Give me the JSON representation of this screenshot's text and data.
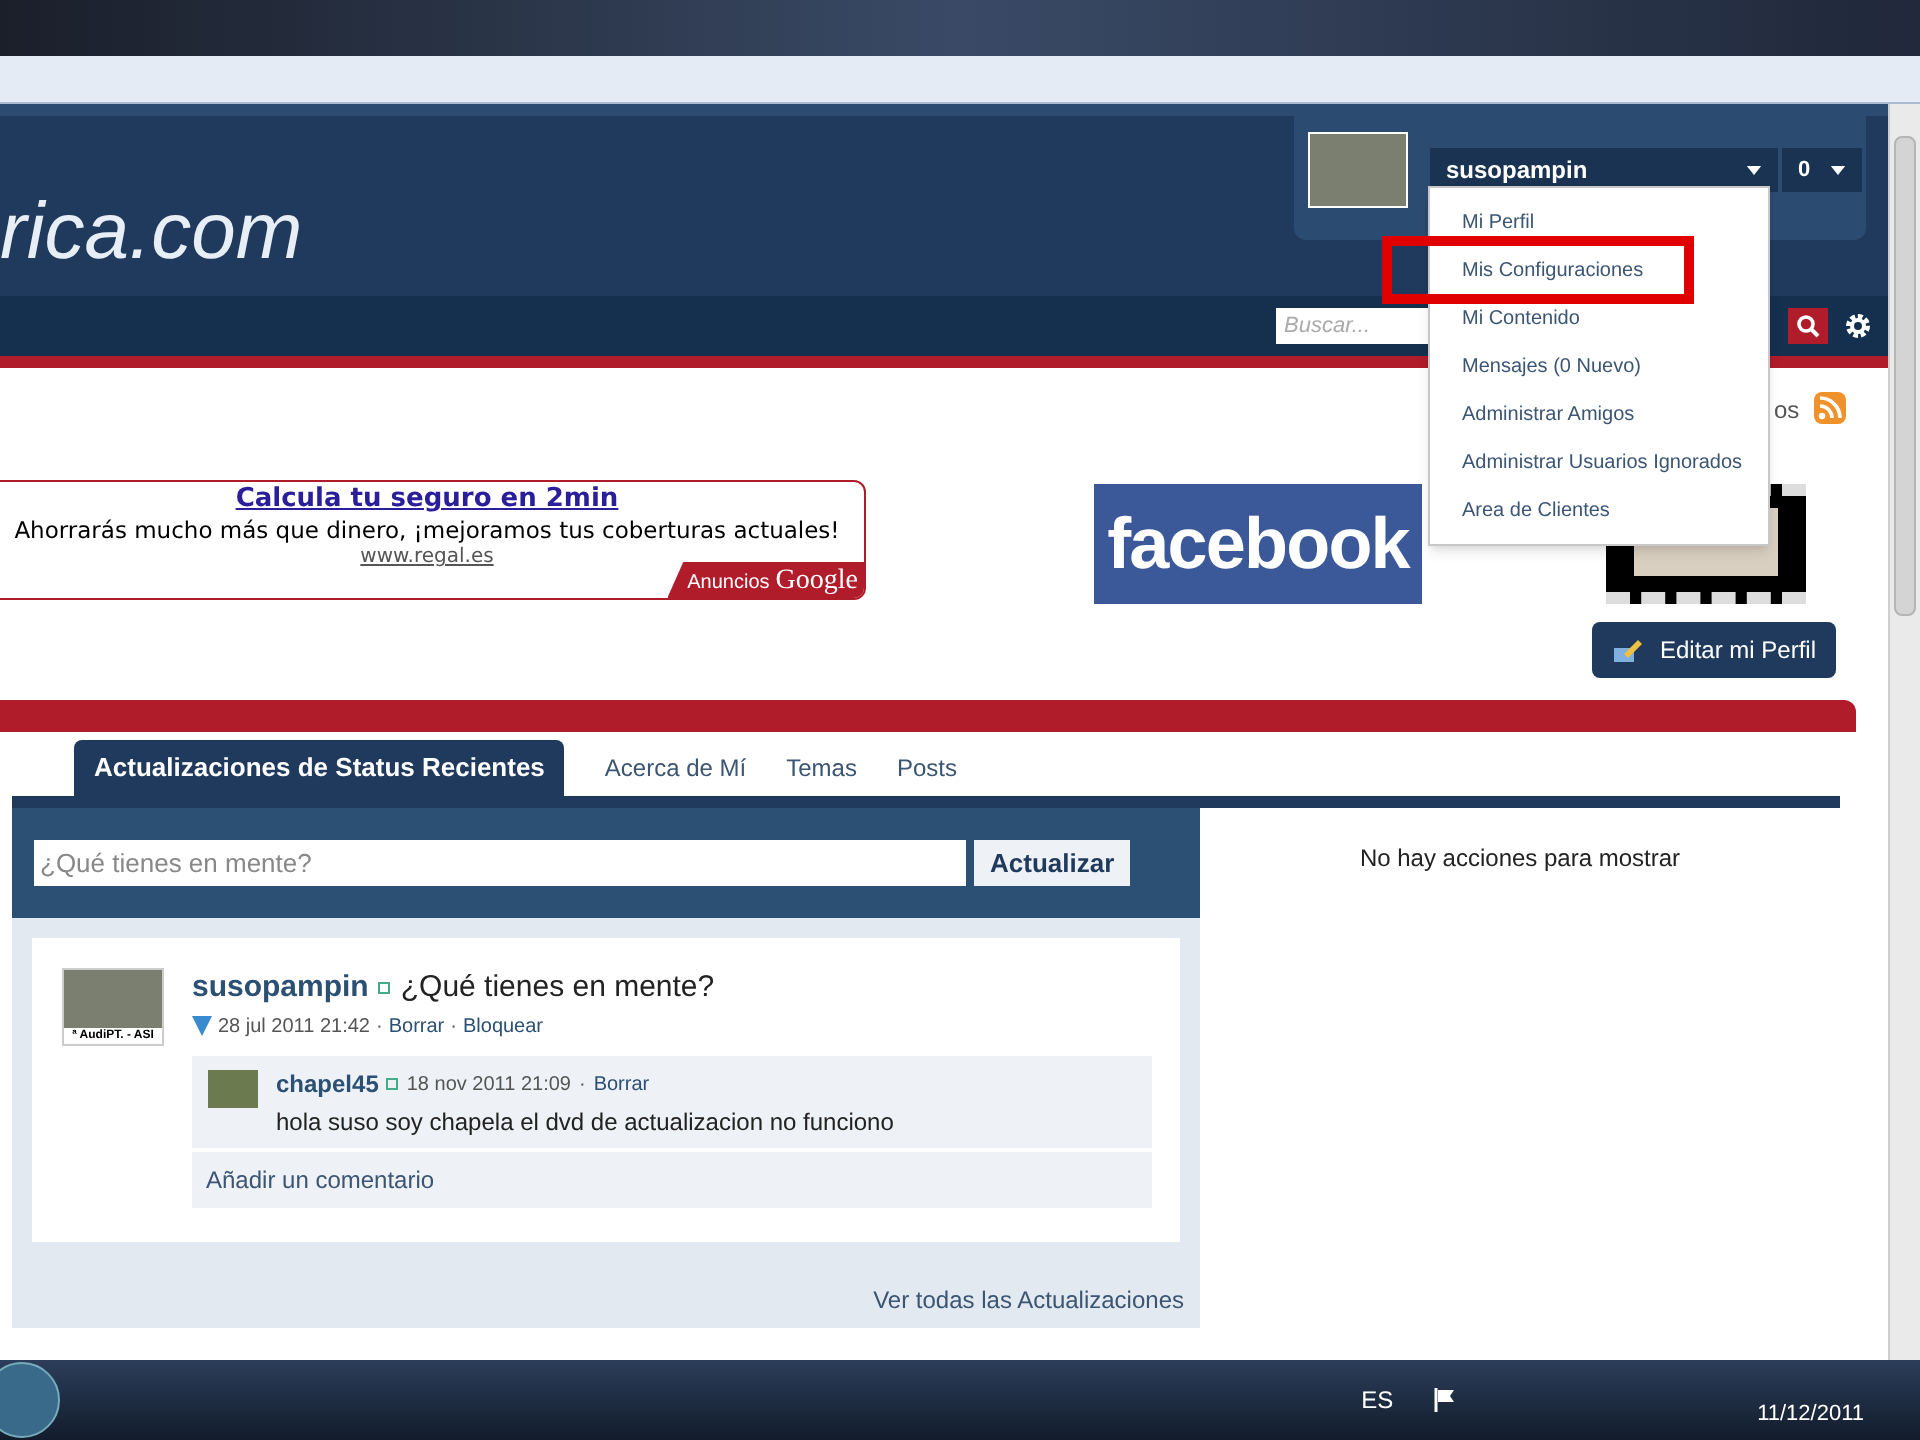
{
  "header": {
    "logo_text": "rica.com",
    "username": "susopampin",
    "notification_count": "0",
    "search": {
      "placeholder": "Buscar..."
    }
  },
  "user_menu": {
    "items": [
      {
        "label": "Mi Perfil",
        "highlighted": false
      },
      {
        "label": "Mis Configuraciones",
        "highlighted": true
      },
      {
        "label": "Mi Contenido",
        "highlighted": false
      },
      {
        "label": "Mensajes (0 Nuevo)",
        "highlighted": false
      },
      {
        "label": "Administrar Amigos",
        "highlighted": false
      },
      {
        "label": "Administrar Usuarios Ignorados",
        "highlighted": false
      },
      {
        "label": "Area de Clientes",
        "highlighted": false
      }
    ]
  },
  "rss_label": "os",
  "ad": {
    "title": "Calcula tu seguro en 2min",
    "text": "Ahorrarás mucho más que dinero, ¡mejoramos tus coberturas actuales!",
    "url": "www.regal.es",
    "label": "Anuncios",
    "brand": "Google"
  },
  "facebook_banner": "facebook",
  "edit_profile_button": "Editar mi Perfil",
  "tabs": [
    {
      "label": "Actualizaciones de Status Recientes",
      "selected": true
    },
    {
      "label": "Acerca de Mí",
      "selected": false
    },
    {
      "label": "Temas",
      "selected": false
    },
    {
      "label": "Posts",
      "selected": false
    }
  ],
  "status_box": {
    "placeholder": "¿Qué tienes en mente?",
    "button": "Actualizar"
  },
  "post": {
    "user": "susopampin",
    "text": "¿Qué tienes en mente?",
    "date": "28 jul 2011 21:42",
    "actions": [
      "Borrar",
      "Bloquear"
    ],
    "avatar_caption": "ª AudiPT. - ASI",
    "comments": [
      {
        "user": "chapel45",
        "date": "18 nov 2011 21:09",
        "actions": [
          "Borrar"
        ],
        "text": "hola suso soy chapela el dvd de actualizacion no funciono"
      }
    ],
    "add_comment": "Añadir un comentario"
  },
  "separator": "·",
  "view_all_link": "Ver todas las Actualizaciones",
  "activity_empty": "No hay acciones para mostrar",
  "taskbar": {
    "language": "ES",
    "date": "11/12/2011"
  }
}
